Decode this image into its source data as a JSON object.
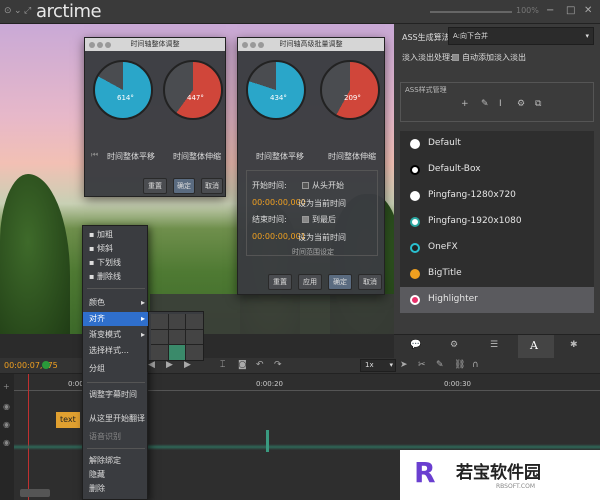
{
  "app": {
    "title": "arctime",
    "zoom_label": "100%"
  },
  "panel1": {
    "title": "时间轴整体调整",
    "dial1_value": "614°",
    "dial1_label": "时间整体平移",
    "dial2_value": "447°",
    "dial2_label": "时间整体伸缩",
    "buttons": [
      "重置",
      "确定",
      "取消"
    ]
  },
  "panel2": {
    "title": "时间轴高级批量调整",
    "dial1_value": "434°",
    "dial1_label": "时间整体平移",
    "dial2_value": "209°",
    "dial2_label": "时间整体伸缩",
    "start_label": "开始时间:",
    "from_start": "从头开始",
    "start_time": "00:00:00,000",
    "set_current1": "设为当前时间",
    "end_label": "结束时间:",
    "to_end": "到最后",
    "end_time": "00:00:00,001",
    "set_current2": "设为当前时间",
    "range_label": "时间范围设定",
    "buttons": [
      "重置",
      "应用",
      "确定",
      "取消"
    ]
  },
  "right": {
    "ass_algo_label": "ASS生成算法:",
    "ass_algo_value": "A:向下合并",
    "fade_label": "淡入淡出处理:",
    "fade_option": "自动添加淡入淡出",
    "style_mgr": "ASS样式管理",
    "styles": [
      {
        "name": "Default"
      },
      {
        "name": "Default-Box"
      },
      {
        "name": "Pingfang-1280x720"
      },
      {
        "name": "Pingfang-1920x1080"
      },
      {
        "name": "OneFX"
      },
      {
        "name": "BigTitle"
      },
      {
        "name": "Highlighter"
      }
    ]
  },
  "colors": {
    "accent_orange": "#f0a020",
    "accent_blue": "#2f6fcc",
    "dial_blue": "#2aa6c9",
    "dial_red": "#d0463a",
    "selected_row": "#5a5a5e"
  },
  "context_menu": {
    "items": [
      "加粗",
      "倾斜",
      "下划线",
      "删除线",
      "颜色",
      "对齐",
      "渐变模式",
      "选择样式…",
      "分组",
      "调整字幕时间",
      "从这里开始翻译",
      "语音识别",
      "解除绑定",
      "隐藏",
      "删除"
    ]
  },
  "timeline": {
    "current_time": "00:00:07,675",
    "speed": "1x",
    "tick1": "0:00:10",
    "tick2": "0:00:20",
    "tick3": "0:00:30",
    "clip_label": "text"
  },
  "watermark": {
    "brand": "若宝软件园",
    "url": "RBSOFT.COM"
  }
}
